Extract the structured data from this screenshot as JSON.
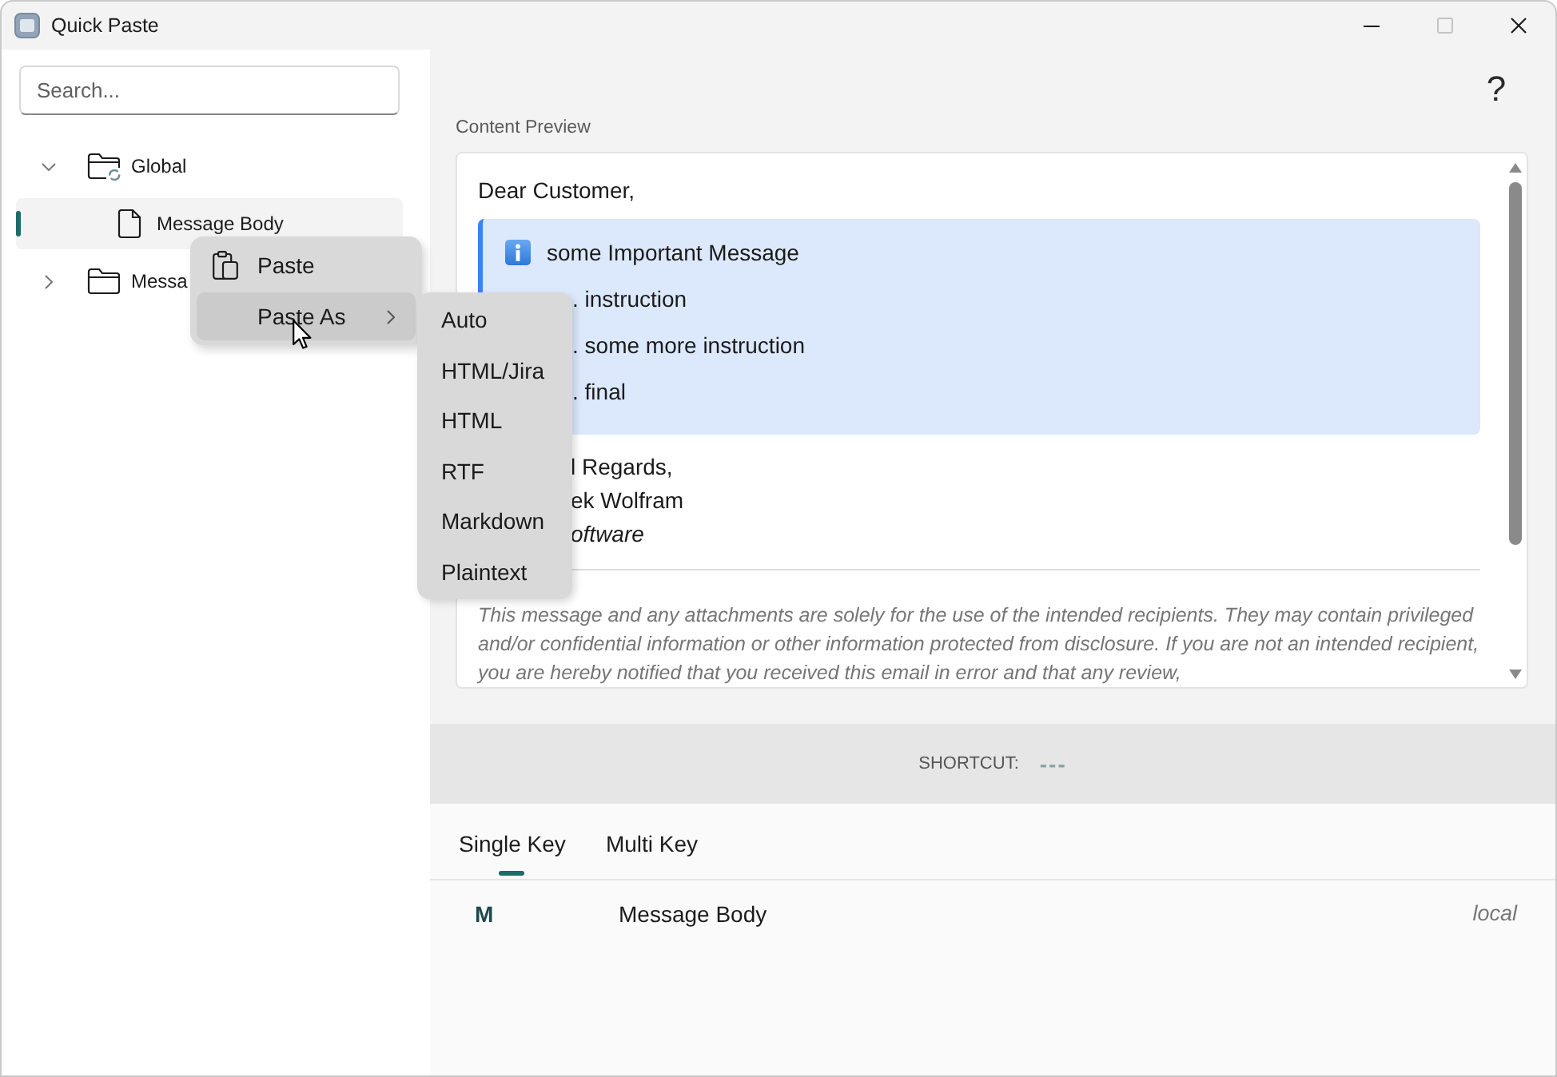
{
  "window": {
    "title": "Quick Paste",
    "controls": [
      {
        "kind": "minimize",
        "disabled": false
      },
      {
        "kind": "maximize",
        "disabled": true
      },
      {
        "kind": "close",
        "disabled": false
      }
    ]
  },
  "search": {
    "placeholder": "Search..."
  },
  "tree": [
    {
      "label": "Global",
      "kind": "synced_folder",
      "expanded": true,
      "selected": false,
      "children": [
        {
          "label": "Message Body",
          "kind": "file",
          "selected": true
        }
      ]
    },
    {
      "label": "Messa",
      "kind": "folder",
      "expanded": false,
      "selected": false
    }
  ],
  "context_menu": {
    "items": [
      {
        "label": "Paste",
        "kind": "command",
        "hovered": false
      },
      {
        "label": "Paste As",
        "kind": "submenu",
        "hovered": true
      }
    ]
  },
  "submenu": {
    "items": [
      "Auto",
      "HTML/Jira",
      "HTML",
      "RTF",
      "Markdown",
      "Plaintext"
    ]
  },
  "help": "?",
  "preview": {
    "label": "Content Preview",
    "greeting": "Dear Customer,",
    "callout": {
      "title": "some Important Message",
      "items": [
        ". instruction",
        ". some more instruction",
        ". final"
      ]
    },
    "signature": [
      {
        "text": "l Regards,",
        "italic": false
      },
      {
        "text": "ek Wolfram",
        "italic": false
      },
      {
        "text": "oftware",
        "italic": true
      }
    ],
    "disclaimer": "This message and any attachments are solely for the use of the intended recipients. They may contain privileged and/or confidential information or other information protected from disclosure. If you are not an intended recipient, you are hereby notified that you received this email in error and that any review,"
  },
  "shortcut": {
    "label": "SHORTCUT:",
    "value": "---"
  },
  "tabs": [
    {
      "label": "Single Key",
      "selected": true
    },
    {
      "label": "Multi Key",
      "selected": false
    }
  ],
  "bindings": [
    {
      "key": "M",
      "name": "Message Body",
      "scope": "local"
    }
  ]
}
